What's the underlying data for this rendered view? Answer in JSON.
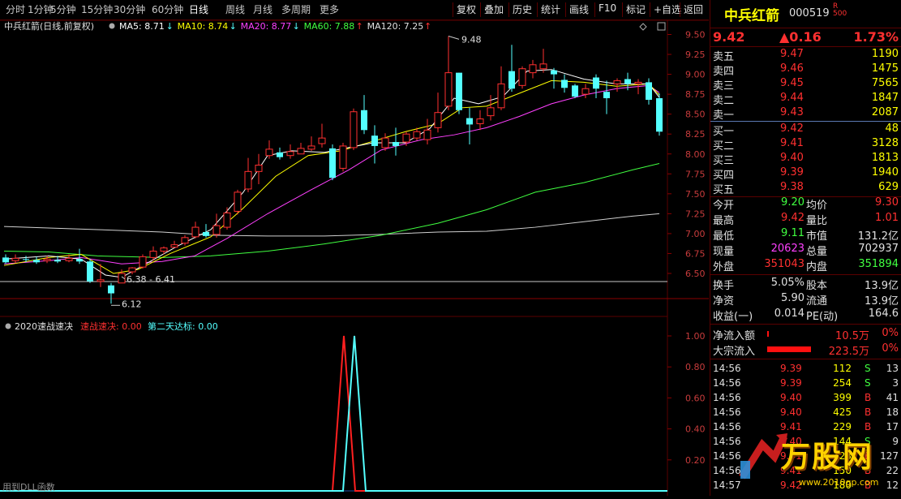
{
  "toolbar": {
    "left_items": [
      "分时",
      "1分钟",
      "5分钟",
      "15分钟",
      "30分钟",
      "60分钟",
      "日线",
      "周线",
      "月线",
      "多周期",
      "更多"
    ],
    "active": "日线",
    "right_items": [
      "复权",
      "叠加",
      "历史",
      "统计",
      "画线",
      "F10",
      "标记",
      "+自选",
      "返回"
    ]
  },
  "main_chart": {
    "header_title": "中兵红箭(日线,前复权)",
    "ma_labels": [
      {
        "text": "MA5: 8.71",
        "color": "#ffffff",
        "arrow": "↓"
      },
      {
        "text": "MA10: 8.74",
        "color": "#ffff00",
        "arrow": "↓"
      },
      {
        "text": "MA20: 8.77",
        "color": "#ff40ff",
        "arrow": "↓"
      },
      {
        "text": "MA60: 7.88",
        "color": "#40ff40",
        "arrow": "↑"
      },
      {
        "text": "MA120: 7.25",
        "color": "#e0e0e0",
        "arrow": "↑"
      }
    ],
    "y_ticks": [
      "9.50",
      "9.25",
      "9.00",
      "8.75",
      "8.50",
      "8.25",
      "8.00",
      "7.75",
      "7.50",
      "7.25",
      "7.00",
      "6.75",
      "6.50"
    ],
    "annotations": {
      "high": "9.48",
      "range": "6.38 - 6.41",
      "low": "6.12"
    }
  },
  "indicator": {
    "title": "2020速战速决",
    "series1_label": "速战速决: 0.00",
    "series2_label": "第二天达标: 0.00",
    "y_ticks": [
      "1.00",
      "0.80",
      "0.60",
      "0.40",
      "0.20"
    ],
    "footer": "用到DLL函数"
  },
  "quote": {
    "name": "中兵红箭",
    "code": "000519",
    "badge_top": "R",
    "badge_bottom": "500",
    "price": "9.42",
    "change": "▲0.16",
    "change_pct": "1.73%",
    "asks": [
      {
        "label": "卖五",
        "price": "9.47",
        "vol": "1190"
      },
      {
        "label": "卖四",
        "price": "9.46",
        "vol": "1475"
      },
      {
        "label": "卖三",
        "price": "9.45",
        "vol": "7565"
      },
      {
        "label": "卖二",
        "price": "9.44",
        "vol": "1847"
      },
      {
        "label": "卖一",
        "price": "9.43",
        "vol": "2087"
      }
    ],
    "bids": [
      {
        "label": "买一",
        "price": "9.42",
        "vol": "48"
      },
      {
        "label": "买二",
        "price": "9.41",
        "vol": "3128"
      },
      {
        "label": "买三",
        "price": "9.40",
        "vol": "1813"
      },
      {
        "label": "买四",
        "price": "9.39",
        "vol": "1940"
      },
      {
        "label": "买五",
        "price": "9.38",
        "vol": "629"
      }
    ],
    "stats1": [
      {
        "l1": "今开",
        "v1": "9.20",
        "c1": "#40ff40",
        "l2": "均价",
        "v2": "9.30",
        "c2": "#ff3030"
      },
      {
        "l1": "最高",
        "v1": "9.42",
        "c1": "#ff3030",
        "l2": "量比",
        "v2": "1.01",
        "c2": "#ff3030"
      },
      {
        "l1": "最低",
        "v1": "9.11",
        "c1": "#40ff40",
        "l2": "市值",
        "v2": "131.2亿",
        "c2": "#e0e0e0"
      },
      {
        "l1": "现量",
        "v1": "20623",
        "c1": "#ff40ff",
        "l2": "总量",
        "v2": "702937",
        "c2": "#e0e0e0"
      },
      {
        "l1": "外盘",
        "v1": "351043",
        "c1": "#ff3030",
        "l2": "内盘",
        "v2": "351894",
        "c2": "#40ff40"
      }
    ],
    "stats2": [
      {
        "l1": "换手",
        "v1": "5.05%",
        "l2": "股本",
        "v2": "13.9亿"
      },
      {
        "l1": "净资",
        "v1": "5.90",
        "l2": "流通",
        "v2": "13.9亿"
      },
      {
        "l1": "收益(一)",
        "v1": "0.014",
        "l2": "PE(动)",
        "v2": "164.6"
      }
    ],
    "flows": [
      {
        "label": "净流入额",
        "value": "10.5万",
        "pct": "0%",
        "bar_fraction": 0.02
      },
      {
        "label": "大宗流入",
        "value": "223.5万",
        "pct": "0%",
        "bar_fraction": 0.45
      }
    ],
    "ticks": [
      {
        "time": "14:56",
        "price": "9.39",
        "vol": "112",
        "dir": "S",
        "n": "13"
      },
      {
        "time": "14:56",
        "price": "9.39",
        "vol": "254",
        "dir": "S",
        "n": "3"
      },
      {
        "time": "14:56",
        "price": "9.40",
        "vol": "399",
        "dir": "B",
        "n": "41"
      },
      {
        "time": "14:56",
        "price": "9.40",
        "vol": "425",
        "dir": "B",
        "n": "18"
      },
      {
        "time": "14:56",
        "price": "9.41",
        "vol": "229",
        "dir": "B",
        "n": "17"
      },
      {
        "time": "14:56",
        "price": "9.40",
        "vol": "144",
        "dir": "S",
        "n": "9"
      },
      {
        "time": "14:56",
        "price": "9.41",
        "vol": "123",
        "dir": "B",
        "n": "127"
      },
      {
        "time": "14:56",
        "price": "9.41",
        "vol": "150",
        "dir": "B",
        "n": "22"
      },
      {
        "time": "14:57",
        "price": "9.42",
        "vol": "180",
        "dir": "B",
        "n": "12"
      }
    ]
  },
  "watermark": {
    "text": "万股网",
    "url": "www.2010gp.com"
  },
  "colors": {
    "up": "#ff3030",
    "down": "#54ffff",
    "border": "#5a0000",
    "background": "#000000"
  }
}
